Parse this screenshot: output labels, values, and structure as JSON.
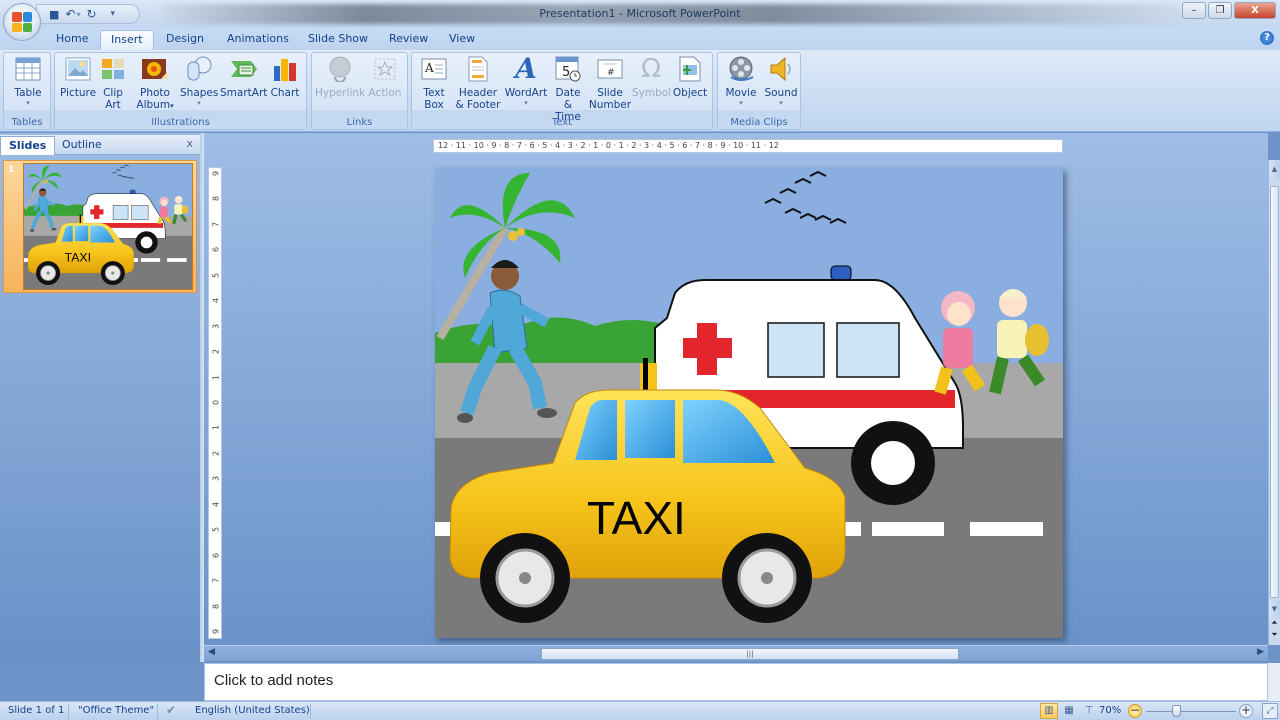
{
  "window": {
    "title": "Presentation1 - Microsoft PowerPoint",
    "controls": {
      "minimize": "–",
      "restore": "❐",
      "close": "X"
    }
  },
  "quick_access": {
    "save_icon": "💾",
    "undo_icon": "↶",
    "undo_dropdown": "▾",
    "redo_icon": "↻",
    "customize_icon": "▾"
  },
  "tabs": [
    {
      "label": "Home",
      "active": false
    },
    {
      "label": "Insert",
      "active": true
    },
    {
      "label": "Design",
      "active": false
    },
    {
      "label": "Animations",
      "active": false
    },
    {
      "label": "Slide Show",
      "active": false
    },
    {
      "label": "Review",
      "active": false
    },
    {
      "label": "View",
      "active": false
    }
  ],
  "help_icon": "?",
  "ribbon": {
    "groups": [
      {
        "label": "Tables",
        "buttons": [
          {
            "line1": "Table",
            "line2": "",
            "dropdown": true,
            "icon": "table-icon",
            "disabled": false
          }
        ]
      },
      {
        "label": "Illustrations",
        "buttons": [
          {
            "line1": "Picture",
            "line2": "",
            "dropdown": false,
            "icon": "picture-icon",
            "disabled": false
          },
          {
            "line1": "Clip",
            "line2": "Art",
            "dropdown": false,
            "icon": "clip-art-icon",
            "disabled": false
          },
          {
            "line1": "Photo",
            "line2": "Album",
            "dropdown": true,
            "icon": "photo-album-icon",
            "disabled": false
          },
          {
            "line1": "Shapes",
            "line2": "",
            "dropdown": true,
            "icon": "shapes-icon",
            "disabled": false
          },
          {
            "line1": "SmartArt",
            "line2": "",
            "dropdown": false,
            "icon": "smartart-icon",
            "disabled": false
          },
          {
            "line1": "Chart",
            "line2": "",
            "dropdown": false,
            "icon": "chart-icon",
            "disabled": false
          }
        ]
      },
      {
        "label": "Links",
        "buttons": [
          {
            "line1": "Hyperlink",
            "line2": "",
            "dropdown": false,
            "icon": "hyperlink-icon",
            "disabled": true
          },
          {
            "line1": "Action",
            "line2": "",
            "dropdown": false,
            "icon": "action-icon",
            "disabled": true
          }
        ]
      },
      {
        "label": "Text",
        "buttons": [
          {
            "line1": "Text",
            "line2": "Box",
            "dropdown": false,
            "icon": "text-box-icon",
            "disabled": false
          },
          {
            "line1": "Header",
            "line2": "& Footer",
            "dropdown": false,
            "icon": "header-footer-icon",
            "disabled": false
          },
          {
            "line1": "WordArt",
            "line2": "",
            "dropdown": true,
            "icon": "wordart-icon",
            "disabled": false
          },
          {
            "line1": "Date",
            "line2": "& Time",
            "dropdown": false,
            "icon": "date-time-icon",
            "disabled": false
          },
          {
            "line1": "Slide",
            "line2": "Number",
            "dropdown": false,
            "icon": "slide-number-icon",
            "disabled": false
          },
          {
            "line1": "Symbol",
            "line2": "",
            "dropdown": false,
            "icon": "symbol-icon",
            "disabled": true
          },
          {
            "line1": "Object",
            "line2": "",
            "dropdown": false,
            "icon": "object-icon",
            "disabled": false
          }
        ]
      },
      {
        "label": "Media Clips",
        "buttons": [
          {
            "line1": "Movie",
            "line2": "",
            "dropdown": true,
            "icon": "movie-icon",
            "disabled": false
          },
          {
            "line1": "Sound",
            "line2": "",
            "dropdown": true,
            "icon": "sound-icon",
            "disabled": false
          }
        ]
      }
    ],
    "glyphs": {
      "caret": "▾",
      "date_num": "5",
      "slide_num": "#",
      "omega": "Ω",
      "wordart": "A",
      "textbox": "A"
    }
  },
  "left_pane": {
    "tabs": [
      {
        "label": "Slides",
        "active": true
      },
      {
        "label": "Outline",
        "active": false
      }
    ],
    "close": "x",
    "slides": [
      {
        "number": "1",
        "selected": true
      }
    ]
  },
  "rulers": {
    "horizontal": "12 · 11 · 10 · 9 · 8 · 7 · 6 · 5 · 4 · 3 · 2 · 1 · 0 · 1 · 2 · 3 · 4 · 5 · 6 · 7 · 8 · 9 · 10 · 11 · 12",
    "vertical": [
      "9",
      "8",
      "7",
      "6",
      "5",
      "4",
      "3",
      "2",
      "1",
      "0",
      "1",
      "2",
      "3",
      "4",
      "5",
      "6",
      "7",
      "8",
      "9"
    ]
  },
  "slide": {
    "taxi_label": "TAXI",
    "colors": {
      "sky": "#8aaedf",
      "road": "#7a7a7a",
      "sidewalk": "#a8a8a8",
      "taxi": "#f6c41a",
      "ambulance_stripe": "#e2262b",
      "cross": "#e2262b",
      "grass": "#3aa335"
    }
  },
  "notes": {
    "placeholder": "Click to add notes"
  },
  "scrollbars": {
    "grip": "|||",
    "left_arrow": "◀",
    "right_arrow": "▶",
    "up_arrow": "▲",
    "down_arrow": "▼",
    "prev_slide": "⏶",
    "next_slide": "⏷"
  },
  "status_bar": {
    "slide_info": "Slide 1 of 1",
    "theme": "\"Office Theme\"",
    "spell_icon": "✔",
    "language": "English (United States)",
    "zoom_level": "70%",
    "zoom_percent": 70,
    "zoom_minus": "−",
    "zoom_plus": "+",
    "fit_icon": "⤢"
  }
}
